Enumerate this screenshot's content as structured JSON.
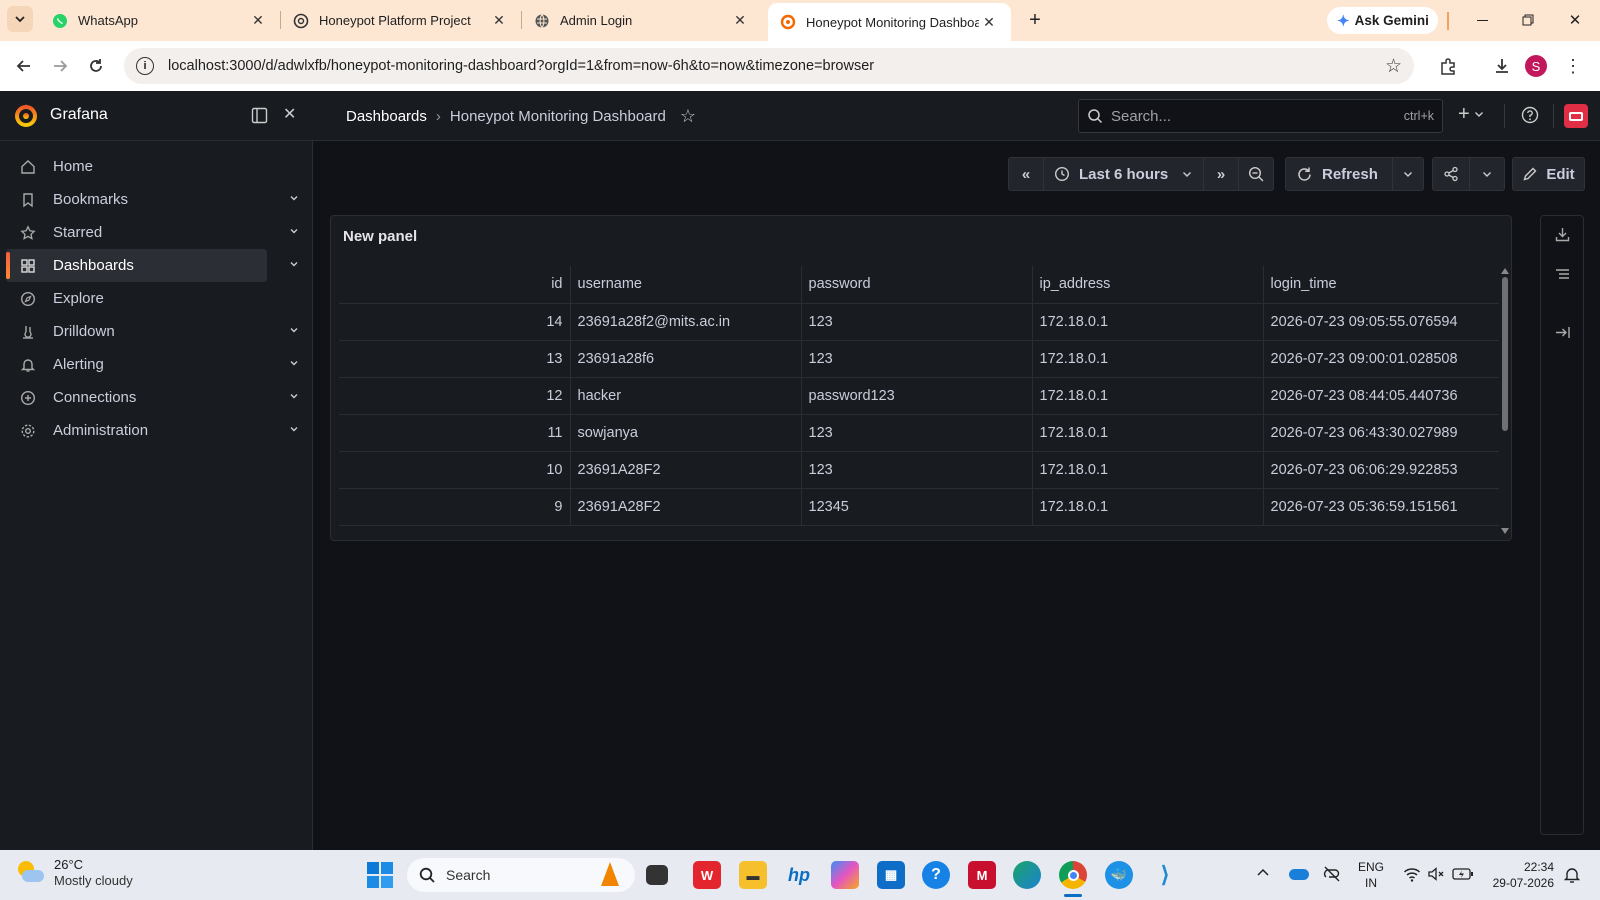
{
  "browser": {
    "tabs": [
      {
        "title": "WhatsApp",
        "icon": "whatsapp-icon",
        "active": false
      },
      {
        "title": "Honeypot Platform Project",
        "icon": "openai-icon",
        "active": false
      },
      {
        "title": "Admin Login",
        "icon": "globe-icon",
        "active": false
      },
      {
        "title": "Honeypot Monitoring Dashboa",
        "icon": "grafana-icon",
        "active": true
      }
    ],
    "new_tab_label": "+",
    "gemini_label": "Ask Gemini",
    "url": "localhost:3000/d/adwlxfb/honeypot-monitoring-dashboard?orgId=1&from=now-6h&to=now&timezone=browser",
    "profile_initial": "S"
  },
  "grafana": {
    "brand": "Grafana",
    "breadcrumb": [
      "Dashboards",
      "Honeypot Monitoring Dashboard"
    ],
    "search_placeholder": "Search...",
    "search_shortcut": "ctrl+k",
    "add_label": "+",
    "sidebar": [
      {
        "label": "Home",
        "icon": "home-icon",
        "expandable": false,
        "active": false
      },
      {
        "label": "Bookmarks",
        "icon": "bookmark-icon",
        "expandable": true,
        "active": false
      },
      {
        "label": "Starred",
        "icon": "star-icon",
        "expandable": true,
        "active": false
      },
      {
        "label": "Dashboards",
        "icon": "apps-icon",
        "expandable": true,
        "active": true
      },
      {
        "label": "Explore",
        "icon": "compass-icon",
        "expandable": false,
        "active": false
      },
      {
        "label": "Drilldown",
        "icon": "drilldown-icon",
        "expandable": true,
        "active": false
      },
      {
        "label": "Alerting",
        "icon": "bell-icon",
        "expandable": true,
        "active": false
      },
      {
        "label": "Connections",
        "icon": "connections-icon",
        "expandable": true,
        "active": false
      },
      {
        "label": "Administration",
        "icon": "cog-icon",
        "expandable": true,
        "active": false
      }
    ],
    "toolbar": {
      "time_range": "Last 6 hours",
      "refresh": "Refresh",
      "edit": "Edit"
    },
    "panel": {
      "title": "New panel",
      "columns": [
        "id",
        "username",
        "password",
        "ip_address",
        "login_time"
      ],
      "rows": [
        [
          "14",
          "23691a28f2@mits.ac.in",
          "123",
          "172.18.0.1",
          "2026-07-23 09:05:55.076594"
        ],
        [
          "13",
          "23691a28f6",
          "123",
          "172.18.0.1",
          "2026-07-23 09:00:01.028508"
        ],
        [
          "12",
          "hacker",
          "password123",
          "172.18.0.1",
          "2026-07-23 08:44:05.440736"
        ],
        [
          "11",
          "sowjanya",
          "123",
          "172.18.0.1",
          "2026-07-23 06:43:30.027989"
        ],
        [
          "10",
          "23691A28F2",
          "123",
          "172.18.0.1",
          "2026-07-23 06:06:29.922853"
        ],
        [
          "9",
          "23691A28F2",
          "12345",
          "172.18.0.1",
          "2026-07-23 05:36:59.151561"
        ]
      ]
    }
  },
  "taskbar": {
    "weather_temp": "26°C",
    "weather_desc": "Mostly cloudy",
    "search_label": "Search",
    "lang": "ENG",
    "region": "IN",
    "time": "22:34",
    "date": "29-07-2026"
  },
  "colors": {
    "grafana_bg": "#111217",
    "grafana_panel": "#181b1f",
    "grafana_accent": "#f55f3e",
    "browser_tabbar": "#fde7d3"
  }
}
